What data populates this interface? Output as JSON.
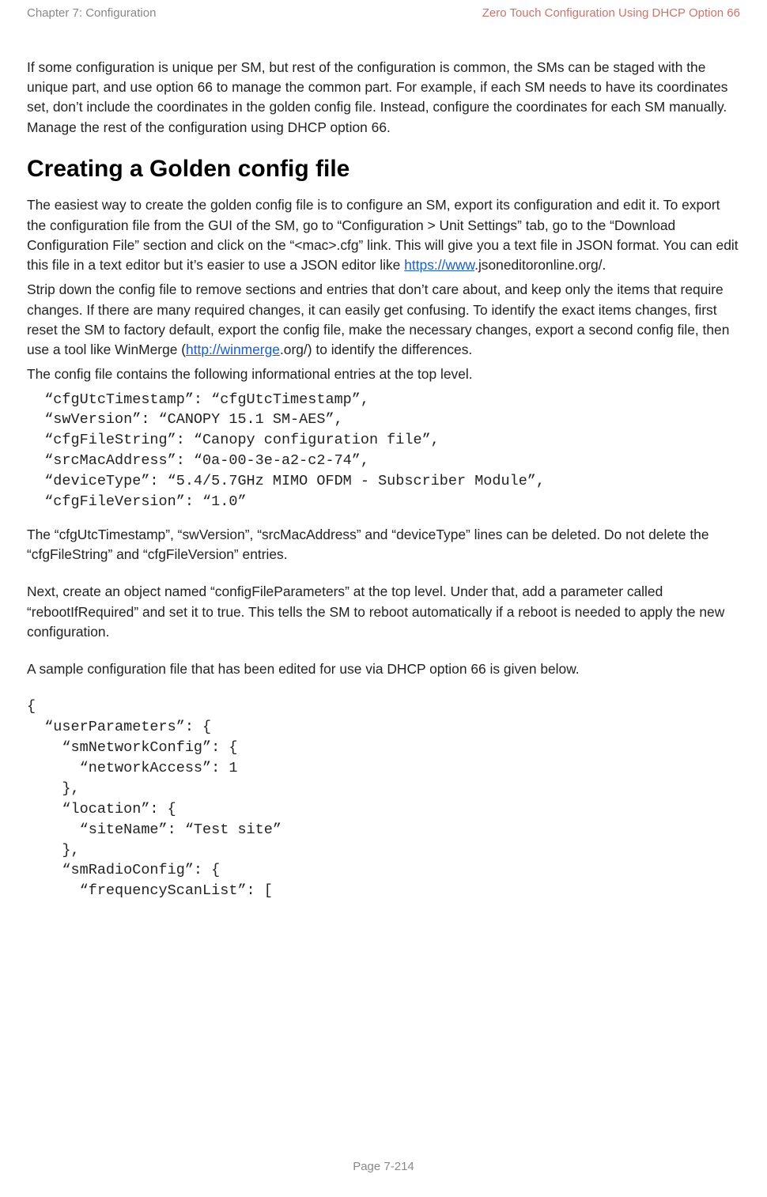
{
  "header": {
    "left": "Chapter 7:  Configuration",
    "right": "Zero Touch Configuration Using DHCP Option 66"
  },
  "intro_paragraph": "If some configuration is unique per SM, but rest of the configuration is common, the SMs can be staged with the unique part, and use option 66 to manage the common part. For example, if each SM needs to have its coordinates set, don’t include the coordinates in the golden config file. Instead, configure the coordinates for each SM manually. Manage the rest of the configuration using DHCP option 66.",
  "section_title": "Creating a Golden config file",
  "para1_part1": "The easiest way to create the golden config file is to configure an SM, export its configuration and edit it. To export the configuration file from the GUI of the SM, go to “Configuration > Unit Settings” tab, go to the “Download Configuration File” section and click on the “<mac>.cfg” link. This will give you a text file in JSON format. You can edit this file in a text editor but it’s easier to use a JSON editor like ",
  "link1_text": "https://www",
  "para1_part2": ".jsoneditoronline.org/.",
  "para2_part1": "Strip down the config file to remove sections and entries that don’t care about, and keep only the items that require changes. If there are many required changes, it can easily get confusing. To identify the exact items changes, first reset the SM to factory default, export the config file, make the necessary changes, export a second config file, then use a tool like WinMerge (",
  "link2_text": "http://winmerge",
  "para2_part2": ".org/) to identify the differences.",
  "para3": "The config file contains the following informational entries at the top level.",
  "code1": "  “cfgUtcTimestamp”: “cfgUtcTimestamp”,\n  “swVersion”: “CANOPY 15.1 SM-AES”,\n  “cfgFileString”: “Canopy configuration file”,\n  “srcMacAddress”: “0a-00-3e-a2-c2-74”,\n  “deviceType”: “5.4/5.7GHz MIMO OFDM - Subscriber Module”,\n  “cfgFileVersion”: “1.0”",
  "para4": "The “cfgUtcTimestamp”, “swVersion”, “srcMacAddress” and “deviceType” lines can be deleted. Do not delete the “cfgFileString” and “cfgFileVersion” entries.",
  "para5": "Next, create an object named “configFileParameters” at the top level. Under that, add a parameter called “rebootIfRequired” and set it to true. This tells the SM to reboot automatically if a reboot is needed to apply the new configuration.",
  "para6": "A sample configuration file that has been edited for use via DHCP option 66 is given below.",
  "code2": "{\n  “userParameters”: {\n    “smNetworkConfig”: {\n      “networkAccess”: 1\n    },\n    “location”: {\n      “siteName”: “Test site”\n    },\n    “smRadioConfig”: {\n      “frequencyScanList”: [",
  "footer": "Page 7-214"
}
